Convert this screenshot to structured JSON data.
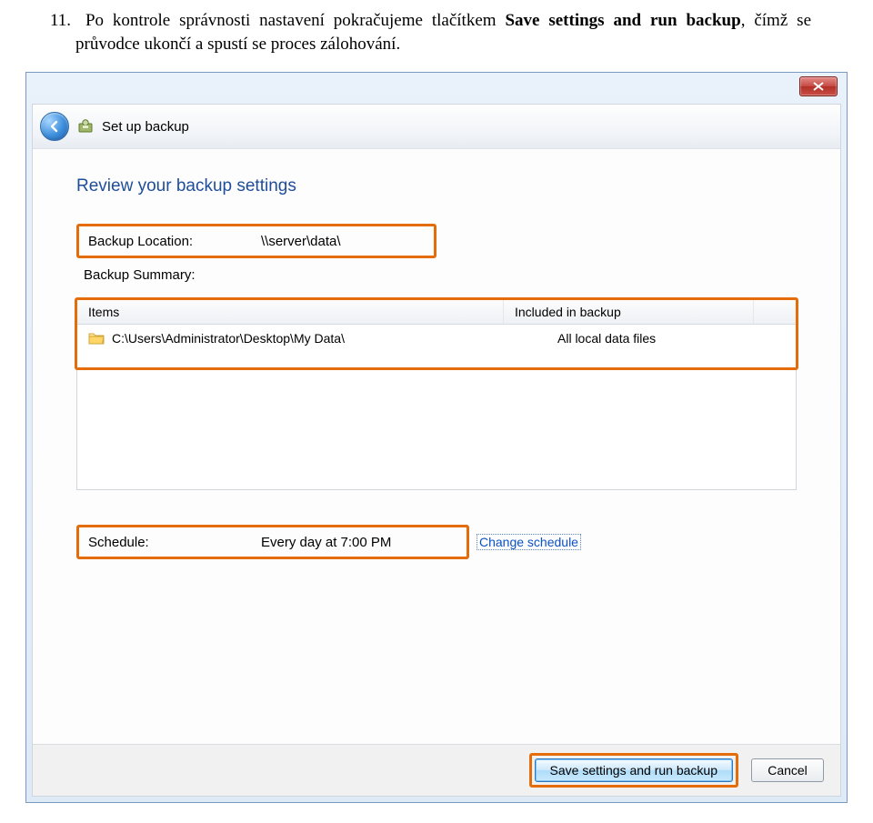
{
  "instruction": {
    "number": "11.",
    "text_before": "Po kontrole správnosti nastavení pokračujeme tlačítkem ",
    "bold": "Save settings and run backup",
    "text_after": ", čímž se průvodce ukončí a spustí se proces zálohování."
  },
  "window": {
    "close_tooltip": "Close",
    "wizard_title": "Set up backup"
  },
  "content": {
    "heading": "Review your backup settings",
    "location_label": "Backup Location:",
    "location_value": "\\\\server\\data\\",
    "summary_label": "Backup Summary:",
    "columns": {
      "items": "Items",
      "included": "Included in backup"
    },
    "rows": [
      {
        "path": "C:\\Users\\Administrator\\Desktop\\My Data\\",
        "included": "All local data files"
      }
    ],
    "schedule_label": "Schedule:",
    "schedule_value": "Every day at 7:00 PM",
    "change_link": "Change schedule"
  },
  "footer": {
    "primary": "Save settings and run backup",
    "cancel": "Cancel"
  }
}
